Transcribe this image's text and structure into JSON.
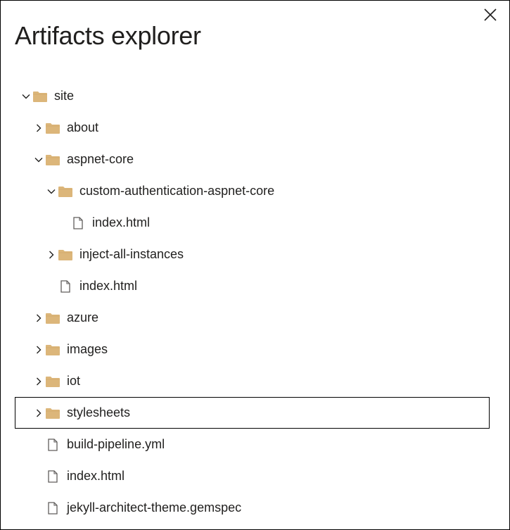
{
  "panel": {
    "title": "Artifacts explorer",
    "close_icon": "close-icon"
  },
  "colors": {
    "folder": "#dcb67a",
    "file_outline": "#605e5c",
    "text": "#201f1e",
    "focus_border": "#000000"
  },
  "tree": [
    {
      "label": "site",
      "type": "folder",
      "depth": 0,
      "expanded": true
    },
    {
      "label": "about",
      "type": "folder",
      "depth": 1,
      "expanded": false
    },
    {
      "label": "aspnet-core",
      "type": "folder",
      "depth": 1,
      "expanded": true
    },
    {
      "label": "custom-authentication-aspnet-core",
      "type": "folder",
      "depth": 2,
      "expanded": true
    },
    {
      "label": "index.html",
      "type": "file",
      "depth": 3
    },
    {
      "label": "inject-all-instances",
      "type": "folder",
      "depth": 2,
      "expanded": false
    },
    {
      "label": "index.html",
      "type": "file",
      "depth": 2
    },
    {
      "label": "azure",
      "type": "folder",
      "depth": 1,
      "expanded": false
    },
    {
      "label": "images",
      "type": "folder",
      "depth": 1,
      "expanded": false
    },
    {
      "label": "iot",
      "type": "folder",
      "depth": 1,
      "expanded": false
    },
    {
      "label": "stylesheets",
      "type": "folder",
      "depth": 1,
      "expanded": false,
      "focused": true
    },
    {
      "label": "build-pipeline.yml",
      "type": "file",
      "depth": 1
    },
    {
      "label": "index.html",
      "type": "file",
      "depth": 1
    },
    {
      "label": "jekyll-architect-theme.gemspec",
      "type": "file",
      "depth": 1
    }
  ]
}
